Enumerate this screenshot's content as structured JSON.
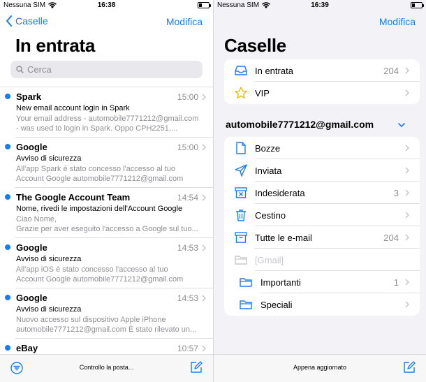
{
  "left": {
    "status": {
      "carrier": "Nessuna SIM",
      "time": "16:38"
    },
    "nav": {
      "back_label": "Caselle",
      "edit_label": "Modifica"
    },
    "title": "In entrata",
    "search": {
      "placeholder": "Cerca"
    },
    "messages": [
      {
        "sender": "Spark",
        "time": "15:00",
        "subject": "New email account login in Spark",
        "preview1": "Your email address - automobile7771212@gmail.com",
        "preview2": "- was used to login in Spark. Oppo CPH2251,...",
        "unread": true
      },
      {
        "sender": "Google",
        "time": "15:00",
        "subject": "Avviso di sicurezza",
        "preview1": "All'app Spark è stato concesso l'accesso al tuo",
        "preview2": "Account Google automobile7771212@gmail.com",
        "unread": true
      },
      {
        "sender": "The Google Account Team",
        "time": "14:54",
        "subject": "Nome, rivedi le impostazioni dell'Account Google",
        "preview1": "Ciao Nome,",
        "preview2": "Grazie per aver eseguito l'accesso a Google sul tuo...",
        "unread": true
      },
      {
        "sender": "Google",
        "time": "14:53",
        "subject": "Avviso di sicurezza",
        "preview1": "All'app iOS è stato concesso l'accesso al tuo",
        "preview2": "Account Google automobile7771212@gmail.com",
        "unread": true
      },
      {
        "sender": "Google",
        "time": "14:53",
        "subject": "Avviso di sicurezza",
        "preview1": "Nuovo accesso sul dispositivo Apple iPhone",
        "preview2": "automobile7771212@gmail.com È stato rilevato un...",
        "unread": true
      },
      {
        "sender": "eBay",
        "time": "10:57",
        "subject": "",
        "preview1": "",
        "preview2": "",
        "unread": true
      }
    ],
    "toolbar": {
      "status_text": "Controllo la posta..."
    }
  },
  "right": {
    "status": {
      "carrier": "Nessuna SIM",
      "time": "16:39"
    },
    "nav": {
      "edit_label": "Modifica"
    },
    "title": "Caselle",
    "top_group": [
      {
        "label": "In entrata",
        "count": "204",
        "icon": "inbox-icon"
      },
      {
        "label": "VIP",
        "count": "",
        "icon": "star-icon"
      }
    ],
    "account": {
      "email": "automobile7771212@gmail.com"
    },
    "folders": [
      {
        "label": "Bozze",
        "count": "",
        "icon": "document-icon"
      },
      {
        "label": "Inviata",
        "count": "",
        "icon": "paper-plane-icon"
      },
      {
        "label": "Indesiderata",
        "count": "3",
        "icon": "junk-icon"
      },
      {
        "label": "Cestino",
        "count": "",
        "icon": "trash-icon"
      },
      {
        "label": "Tutte le e-mail",
        "count": "204",
        "icon": "archive-icon"
      },
      {
        "label": "[Gmail]",
        "count": "",
        "icon": "folder-icon"
      },
      {
        "label": "Importanti",
        "count": "1",
        "icon": "folder-icon"
      },
      {
        "label": "Speciali",
        "count": "",
        "icon": "folder-icon"
      }
    ],
    "toolbar": {
      "status_text": "Appena aggiornato"
    }
  },
  "colors": {
    "accent": "#1a7cf2",
    "secondary_text": "#8e8e93",
    "grouped_bg": "#f2f2f7"
  }
}
